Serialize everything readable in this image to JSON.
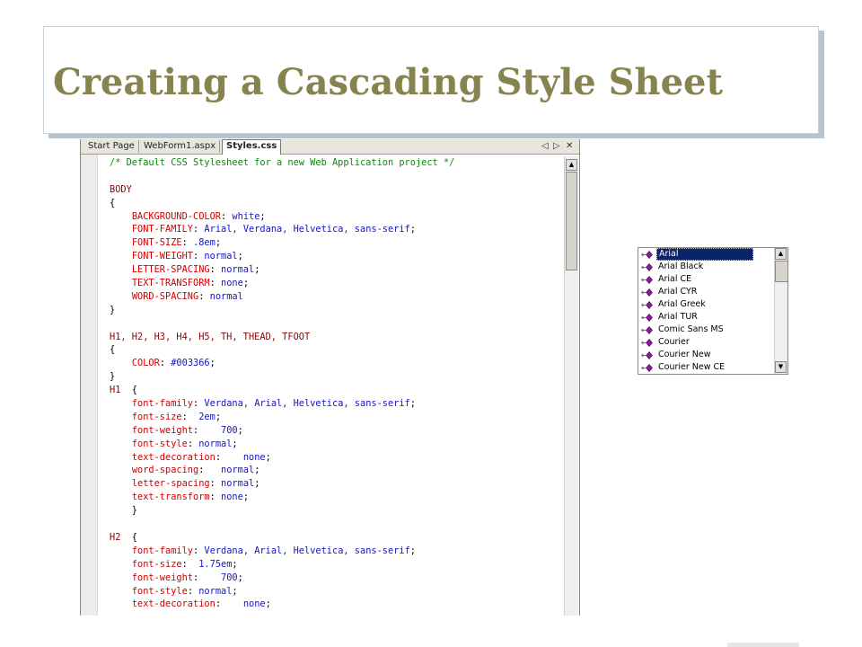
{
  "slide": {
    "title": "Creating a Cascading Style Sheet"
  },
  "editor": {
    "tabs": [
      {
        "label": "Start Page",
        "active": false
      },
      {
        "label": "WebForm1.aspx",
        "active": false
      },
      {
        "label": "Styles.css",
        "active": true
      }
    ],
    "tab_controls": {
      "prev": "◁",
      "next": "▷",
      "close": "✕"
    },
    "scroll_up": "▲",
    "scroll_down": "▼"
  },
  "code_lines": [
    [
      {
        "t": "/* Default CSS Stylesheet for a new Web Application project */",
        "c": "cm"
      }
    ],
    [],
    [
      {
        "t": "BODY",
        "c": "sel"
      }
    ],
    [
      {
        "t": "{",
        "c": "pun"
      }
    ],
    [
      {
        "t": "    ",
        "c": "pun"
      },
      {
        "t": "BACKGROUND-COLOR",
        "c": "prop"
      },
      {
        "t": ": ",
        "c": "pun"
      },
      {
        "t": "white",
        "c": "val"
      },
      {
        "t": ";",
        "c": "pun"
      }
    ],
    [
      {
        "t": "    ",
        "c": "pun"
      },
      {
        "t": "FONT-FAMILY",
        "c": "prop"
      },
      {
        "t": ": ",
        "c": "pun"
      },
      {
        "t": "Arial, Verdana, Helvetica, sans-serif",
        "c": "val"
      },
      {
        "t": ";",
        "c": "pun"
      }
    ],
    [
      {
        "t": "    ",
        "c": "pun"
      },
      {
        "t": "FONT-SIZE",
        "c": "prop"
      },
      {
        "t": ": ",
        "c": "pun"
      },
      {
        "t": ".8em",
        "c": "val"
      },
      {
        "t": ";",
        "c": "pun"
      }
    ],
    [
      {
        "t": "    ",
        "c": "pun"
      },
      {
        "t": "FONT-WEIGHT",
        "c": "prop"
      },
      {
        "t": ": ",
        "c": "pun"
      },
      {
        "t": "normal",
        "c": "val"
      },
      {
        "t": ";",
        "c": "pun"
      }
    ],
    [
      {
        "t": "    ",
        "c": "pun"
      },
      {
        "t": "LETTER-SPACING",
        "c": "prop"
      },
      {
        "t": ": ",
        "c": "pun"
      },
      {
        "t": "normal",
        "c": "val"
      },
      {
        "t": ";",
        "c": "pun"
      }
    ],
    [
      {
        "t": "    ",
        "c": "pun"
      },
      {
        "t": "TEXT-TRANSFORM",
        "c": "prop"
      },
      {
        "t": ": ",
        "c": "pun"
      },
      {
        "t": "none",
        "c": "val"
      },
      {
        "t": ";",
        "c": "pun"
      }
    ],
    [
      {
        "t": "    ",
        "c": "pun"
      },
      {
        "t": "WORD-SPACING",
        "c": "prop"
      },
      {
        "t": ": ",
        "c": "pun"
      },
      {
        "t": "normal",
        "c": "val"
      }
    ],
    [
      {
        "t": "}",
        "c": "pun"
      }
    ],
    [],
    [
      {
        "t": "H1, H2, H3, H4, H5, TH, THEAD, TFOOT",
        "c": "sel"
      }
    ],
    [
      {
        "t": "{",
        "c": "pun"
      }
    ],
    [
      {
        "t": "    ",
        "c": "pun"
      },
      {
        "t": "COLOR",
        "c": "prop"
      },
      {
        "t": ": ",
        "c": "pun"
      },
      {
        "t": "#003366",
        "c": "val"
      },
      {
        "t": ";",
        "c": "pun"
      }
    ],
    [
      {
        "t": "}",
        "c": "pun"
      }
    ],
    [
      {
        "t": "H1",
        "c": "sel"
      },
      {
        "t": "  {",
        "c": "pun"
      }
    ],
    [
      {
        "t": "    ",
        "c": "pun"
      },
      {
        "t": "font-family",
        "c": "prop"
      },
      {
        "t": ": ",
        "c": "pun"
      },
      {
        "t": "Verdana, Arial, Helvetica, sans-serif",
        "c": "val"
      },
      {
        "t": ";",
        "c": "pun"
      }
    ],
    [
      {
        "t": "    ",
        "c": "pun"
      },
      {
        "t": "font-size",
        "c": "prop"
      },
      {
        "t": ":  ",
        "c": "pun"
      },
      {
        "t": "2em",
        "c": "val"
      },
      {
        "t": ";",
        "c": "pun"
      }
    ],
    [
      {
        "t": "    ",
        "c": "pun"
      },
      {
        "t": "font-weight",
        "c": "prop"
      },
      {
        "t": ":    ",
        "c": "pun"
      },
      {
        "t": "700",
        "c": "val"
      },
      {
        "t": ";",
        "c": "pun"
      }
    ],
    [
      {
        "t": "    ",
        "c": "pun"
      },
      {
        "t": "font-style",
        "c": "prop"
      },
      {
        "t": ": ",
        "c": "pun"
      },
      {
        "t": "normal",
        "c": "val"
      },
      {
        "t": ";",
        "c": "pun"
      }
    ],
    [
      {
        "t": "    ",
        "c": "pun"
      },
      {
        "t": "text-decoration",
        "c": "prop"
      },
      {
        "t": ":    ",
        "c": "pun"
      },
      {
        "t": "none",
        "c": "val"
      },
      {
        "t": ";",
        "c": "pun"
      }
    ],
    [
      {
        "t": "    ",
        "c": "pun"
      },
      {
        "t": "word-spacing",
        "c": "prop"
      },
      {
        "t": ":   ",
        "c": "pun"
      },
      {
        "t": "normal",
        "c": "val"
      },
      {
        "t": ";",
        "c": "pun"
      }
    ],
    [
      {
        "t": "    ",
        "c": "pun"
      },
      {
        "t": "letter-spacing",
        "c": "prop"
      },
      {
        "t": ": ",
        "c": "pun"
      },
      {
        "t": "normal",
        "c": "val"
      },
      {
        "t": ";",
        "c": "pun"
      }
    ],
    [
      {
        "t": "    ",
        "c": "pun"
      },
      {
        "t": "text-transform",
        "c": "prop"
      },
      {
        "t": ": ",
        "c": "pun"
      },
      {
        "t": "none",
        "c": "val"
      },
      {
        "t": ";",
        "c": "pun"
      }
    ],
    [
      {
        "t": "    }",
        "c": "pun"
      }
    ],
    [],
    [
      {
        "t": "H2",
        "c": "sel"
      },
      {
        "t": "  {",
        "c": "pun"
      }
    ],
    [
      {
        "t": "    ",
        "c": "pun"
      },
      {
        "t": "font-family",
        "c": "prop"
      },
      {
        "t": ": ",
        "c": "pun"
      },
      {
        "t": "Verdana, Arial, Helvetica, sans-serif",
        "c": "val"
      },
      {
        "t": ";",
        "c": "pun"
      }
    ],
    [
      {
        "t": "    ",
        "c": "pun"
      },
      {
        "t": "font-size",
        "c": "prop"
      },
      {
        "t": ":  ",
        "c": "pun"
      },
      {
        "t": "1.75em",
        "c": "val"
      },
      {
        "t": ";",
        "c": "pun"
      }
    ],
    [
      {
        "t": "    ",
        "c": "pun"
      },
      {
        "t": "font-weight",
        "c": "prop"
      },
      {
        "t": ":    ",
        "c": "pun"
      },
      {
        "t": "700",
        "c": "val"
      },
      {
        "t": ";",
        "c": "pun"
      }
    ],
    [
      {
        "t": "    ",
        "c": "pun"
      },
      {
        "t": "font-style",
        "c": "prop"
      },
      {
        "t": ": ",
        "c": "pun"
      },
      {
        "t": "normal",
        "c": "val"
      },
      {
        "t": ";",
        "c": "pun"
      }
    ],
    [
      {
        "t": "    ",
        "c": "pun"
      },
      {
        "t": "text-decoration",
        "c": "prop"
      },
      {
        "t": ":    ",
        "c": "pun"
      },
      {
        "t": "none",
        "c": "val"
      },
      {
        "t": ";",
        "c": "pun"
      }
    ]
  ],
  "font_list": {
    "items": [
      "Arial",
      "Arial Black",
      "Arial CE",
      "Arial CYR",
      "Arial Greek",
      "Arial TUR",
      "Comic Sans MS",
      "Courier",
      "Courier New",
      "Courier New CE"
    ],
    "selected_index": 0,
    "item_icon": "font-item-icon"
  },
  "colors": {
    "title": "#87834f",
    "comment": "#0a8a0a",
    "selector": "#8b0000",
    "property": "#d10000",
    "value": "#1414c8",
    "selection": "#0a246a"
  }
}
